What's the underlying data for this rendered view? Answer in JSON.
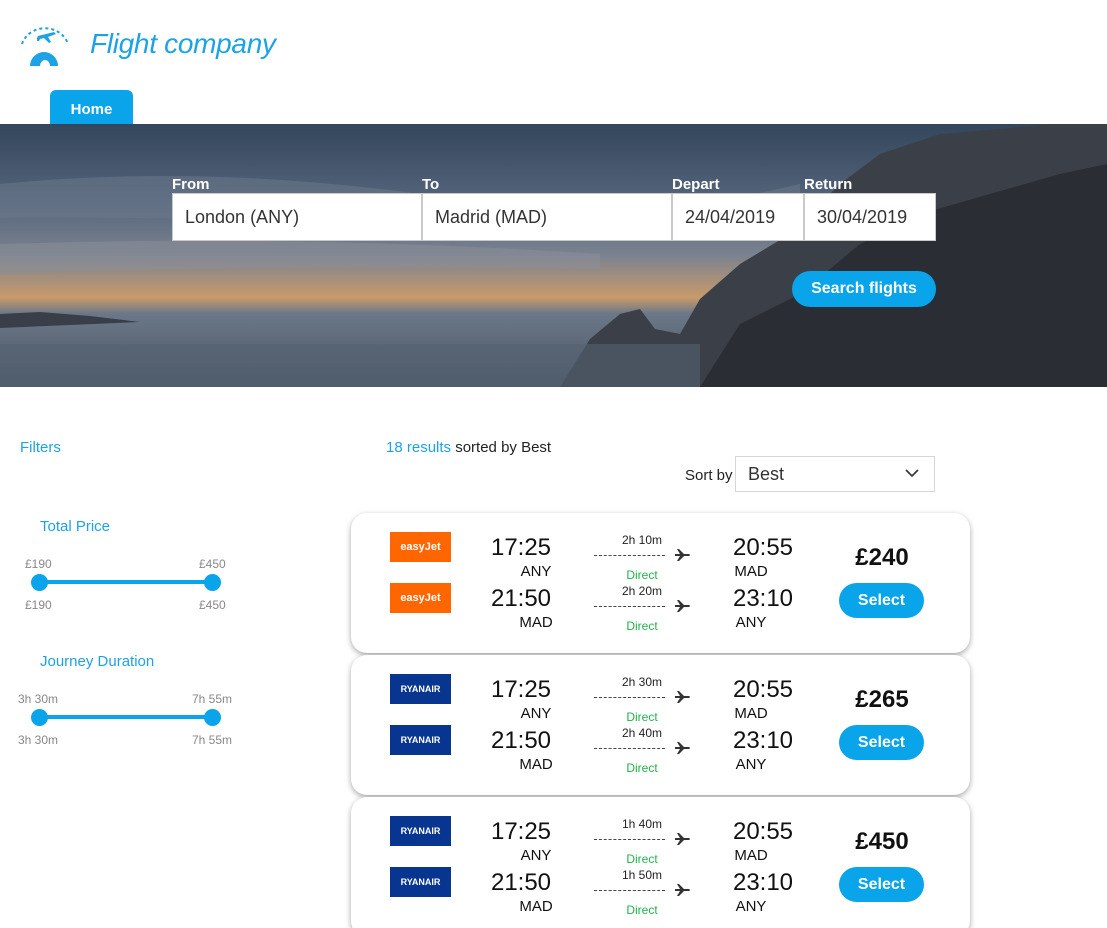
{
  "header": {
    "brand": "Flight company",
    "nav_tab": "Home"
  },
  "search": {
    "from_label": "From",
    "from_value": "London (ANY)",
    "to_label": "To",
    "to_value": "Madrid (MAD)",
    "depart_label": "Depart",
    "depart_value": "24/04/2019",
    "return_label": "Return",
    "return_value": "30/04/2019",
    "button": "Search flights"
  },
  "filters": {
    "title": "Filters",
    "price": {
      "title": "Total Price",
      "min_top": "£190",
      "max_top": "£450",
      "min_bottom": "£190",
      "max_bottom": "£450"
    },
    "duration": {
      "title": "Journey Duration",
      "min_top": "3h 30m",
      "max_top": "7h 55m",
      "min_bottom": "3h 30m",
      "max_bottom": "7h 55m"
    }
  },
  "results": {
    "count": "18 results",
    "sorted_text": " sorted by Best",
    "sort_label": "Sort by",
    "sort_value": "Best",
    "items": [
      {
        "airline": "easyJet",
        "logo_text": "easyJet",
        "price": "£240",
        "select": "Select",
        "outbound": {
          "dep_time": "17:25",
          "dep_code": "ANY",
          "duration": "2h 10m",
          "stops": "Direct",
          "arr_time": "20:55",
          "arr_code": "MAD"
        },
        "inbound": {
          "dep_time": "21:50",
          "dep_code": "MAD",
          "duration": "2h 20m",
          "stops": "Direct",
          "arr_time": "23:10",
          "arr_code": "ANY"
        }
      },
      {
        "airline": "Ryanair",
        "logo_text": "RYANAIR",
        "price": "£265",
        "select": "Select",
        "outbound": {
          "dep_time": "17:25",
          "dep_code": "ANY",
          "duration": "2h 30m",
          "stops": "Direct",
          "arr_time": "20:55",
          "arr_code": "MAD"
        },
        "inbound": {
          "dep_time": "21:50",
          "dep_code": "MAD",
          "duration": "2h 40m",
          "stops": "Direct",
          "arr_time": "23:10",
          "arr_code": "ANY"
        }
      },
      {
        "airline": "Ryanair",
        "logo_text": "RYANAIR",
        "price": "£450",
        "select": "Select",
        "outbound": {
          "dep_time": "17:25",
          "dep_code": "ANY",
          "duration": "1h 40m",
          "stops": "Direct",
          "arr_time": "20:55",
          "arr_code": "MAD"
        },
        "inbound": {
          "dep_time": "21:50",
          "dep_code": "MAD",
          "duration": "1h 50m",
          "stops": "Direct",
          "arr_time": "23:10",
          "arr_code": "ANY"
        }
      }
    ]
  },
  "colors": {
    "accent": "#0aa4ea",
    "brand_text": "#1ea2e6",
    "direct": "#21b24a",
    "easyjet": "#ff6600",
    "ryanair": "#073590"
  },
  "icons": [
    "logo-plane-globe-icon",
    "airplane-icon",
    "chevron-down-icon"
  ]
}
